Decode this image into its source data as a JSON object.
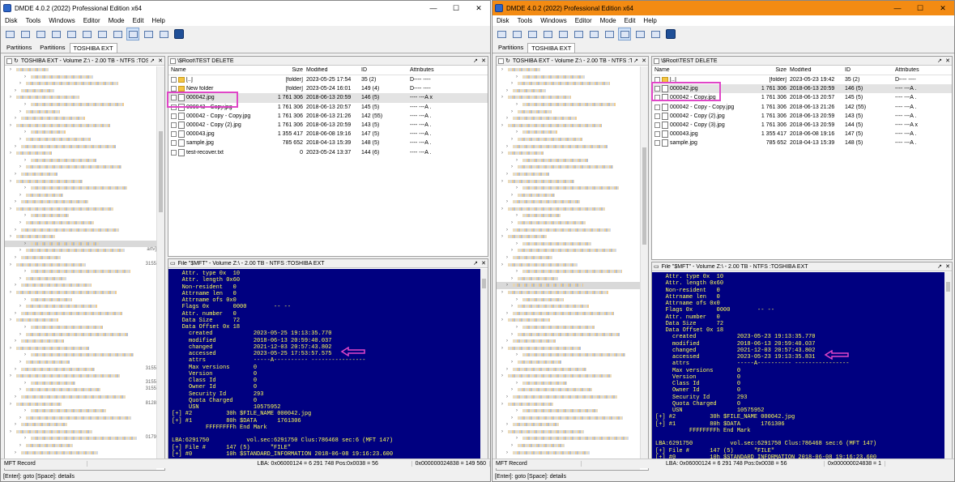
{
  "left": {
    "title": "DMDE 4.0.2 (2022) Professional Edition x64",
    "menu": [
      "Disk",
      "Tools",
      "Windows",
      "Editor",
      "Mode",
      "Edit",
      "Help"
    ],
    "tabs": [
      "Partitions",
      "Partitions",
      "TOSHIBA EXT"
    ],
    "tree_header": "TOSHIBA EXT - Volume Z:\\ - 2.00 TB - NTFS :TOS...",
    "tree_side_labels": [
      "artv]",
      "3155",
      "3155",
      "3155",
      "3155",
      "8128",
      "0179"
    ],
    "file_header": "\\$Root\\TEST DELETE",
    "columns": [
      "Name",
      "Size",
      "Modified",
      "ID",
      "Attributes"
    ],
    "files": [
      {
        "name": "[..]",
        "size": "[folder]",
        "modified": "2023-05-25 17:54",
        "id": "35 (2)",
        "attr": "D---- ----",
        "type": "folder"
      },
      {
        "name": "New folder",
        "size": "[folder]",
        "modified": "2023-05-24 16:01",
        "id": "149 (4)",
        "attr": "D---- ----",
        "type": "folder"
      },
      {
        "name": "000042.jpg",
        "size": "1 761 306",
        "modified": "2018-06-13 20:59",
        "id": "146 (5)",
        "attr": "---- ---A x",
        "type": "file"
      },
      {
        "name": "000042 - Copy.jpg",
        "size": "1 761 306",
        "modified": "2018-06-13 20:57",
        "id": "145 (5)",
        "attr": "---- ---A .",
        "type": "file"
      },
      {
        "name": "000042 - Copy - Copy.jpg",
        "size": "1 761 306",
        "modified": "2018-06-13 21:26",
        "id": "142 (55)",
        "attr": "---- ---A .",
        "type": "file"
      },
      {
        "name": "000042 - Copy (2).jpg",
        "size": "1 761 306",
        "modified": "2018-06-13 20:59",
        "id": "143 (5)",
        "attr": "---- ---A .",
        "type": "file"
      },
      {
        "name": "000043.jpg",
        "size": "1 355 417",
        "modified": "2018-06-08 19:16",
        "id": "147 (5)",
        "attr": "---- ---A .",
        "type": "file"
      },
      {
        "name": "sample.jpg",
        "size": "785 652",
        "modified": "2018-04-13 15:39",
        "id": "148 (5)",
        "attr": "---- ---A .",
        "type": "file"
      },
      {
        "name": "test-recover.txt",
        "size": "0",
        "modified": "2023-05-24 13:37",
        "id": "144 (6)",
        "attr": "---- ---A .",
        "type": "file"
      }
    ],
    "mft_header": "File \"$MFT\" - Volume Z:\\ - 2.00 TB - NTFS :TOSHIBA EXT",
    "mft_lines": [
      "   Attr. type 0x  10",
      "   Attr. length 0x60",
      "   Non-resident   0",
      "   Attrname len   0",
      "   Attrname ofs 0x0",
      "   Flags 0x       0000        -- --",
      "   Attr. number   0",
      "   Data Size      72",
      "   Data Offset 0x 18",
      "     created            2023-05-25 19:13:35.770",
      "     modified           2018-06-13 20:59:40.037",
      "     changed            2021-12-03 20:57:43.802",
      "     accessed           2023-05-25 17:53:57.575",
      "     attrs              -----A---------- ----------------",
      "     Max versions       0",
      "     Version            0",
      "     Class Id           0",
      "     Owner Id           0",
      "     Security Id        293",
      "     Quota Charged      0",
      "     USN                10575952",
      "[+] #2          30h $FILE_NAME 000042.jpg",
      "[+] #1          80h $DATA      1761306",
      "          FFFFFFFFh End Mark",
      "",
      "LBA:6291750           vol.sec:6291750 Clus:786468 sec:6 (MFT 147)",
      "[+] File #      147 (5)      \"FILE\"",
      "[+] #0          10h $STANDARD_INFORMATION 2018-06-08 19:16:23.600"
    ],
    "status": [
      "MFT Record",
      "LBA: 0x06000124 = 6 291 748  Pos:0x0038 = 56",
      "0x000000024838 = 149 560"
    ],
    "bottom_help": "[Enter]: goto  [Space]: details"
  },
  "right": {
    "title": "DMDE 4.0.2 (2022) Professional Edition x64",
    "menu": [
      "Disk",
      "Tools",
      "Windows",
      "Editor",
      "Mode",
      "Edit",
      "Help"
    ],
    "tabs": [
      "Partitions",
      "TOSHIBA EXT"
    ],
    "tree_header": "TOSHIBA EXT - Volume Z:\\ - 2.00 TB - NTFS :TOS...",
    "file_header": "\\$Root\\TEST DELETE",
    "columns": [
      "Name",
      "Size",
      "Modified",
      "ID",
      "Attributes"
    ],
    "files": [
      {
        "name": "[..]",
        "size": "[folder]",
        "modified": "2023-05-23 19:42",
        "id": "35 (2)",
        "attr": "D---- ----",
        "type": "folder"
      },
      {
        "name": "000042.jpg",
        "size": "1 761 306",
        "modified": "2018-06-13 20:59",
        "id": "146 (5)",
        "attr": "---- ---A .",
        "type": "file"
      },
      {
        "name": "000042 - Copy.jpg",
        "size": "1 761 306",
        "modified": "2018-06-13 20:57",
        "id": "145 (5)",
        "attr": "---- ---A .",
        "type": "file"
      },
      {
        "name": "000042 - Copy - Copy.jpg",
        "size": "1 761 306",
        "modified": "2018-06-13 21:26",
        "id": "142 (55)",
        "attr": "---- ---A .",
        "type": "file"
      },
      {
        "name": "000042 - Copy (2).jpg",
        "size": "1 761 306",
        "modified": "2018-06-13 20:59",
        "id": "143 (5)",
        "attr": "---- ---A .",
        "type": "file"
      },
      {
        "name": "000042 - Copy (3).jpg",
        "size": "1 761 306",
        "modified": "2018-06-13 20:59",
        "id": "144 (5)",
        "attr": "---- ---A x",
        "type": "file"
      },
      {
        "name": "000043.jpg",
        "size": "1 355 417",
        "modified": "2018-06-08 19:16",
        "id": "147 (5)",
        "attr": "---- ---A .",
        "type": "file"
      },
      {
        "name": "sample.jpg",
        "size": "785 652",
        "modified": "2018-04-13 15:39",
        "id": "148 (5)",
        "attr": "---- ---A .",
        "type": "file"
      }
    ],
    "mft_header": "File \"$MFT\" - Volume Z:\\ - 2.00 TB - NTFS :TOSHIBA EXT",
    "mft_lines": [
      "   Attr. type 0x  10",
      "   Attr. length 0x60",
      "   Non-resident   0",
      "   Attrname len   0",
      "   Attrname ofs 0x0",
      "   Flags 0x       0000        -- --",
      "   Attr. number   0",
      "   Data Size      72",
      "   Data Offset 0x 18",
      "     created            2023-05-23 19:13:35.770",
      "     modified           2018-06-13 20:59:40.037",
      "     changed            2021-12-03 20:57:43.802",
      "     accessed           2023-05-23 19:13:35.831",
      "     attrs              -----A---------- ----------------",
      "     Max versions       0",
      "     Version            0",
      "     Class Id           0",
      "     Owner Id           0",
      "     Security Id        293",
      "     Quota Charged      0",
      "     USN                10575952",
      "[+] #2          30h $FILE_NAME 000042.jpg",
      "[+] #1          80h $DATA      1761306",
      "          FFFFFFFFh End Mark",
      "",
      "LBA:6291750           vol.sec:6291750 Clus:786468 sec:6 (MFT 147)",
      "[+] File #      147 (5)      \"FILE\"",
      "[+] #0          10h $STANDARD_INFORMATION 2018-06-08 19:16:23.600"
    ],
    "status": [
      "MFT Record",
      "LBA: 0x06000124 = 6 291 748  Pos:0x0038 = 56",
      "0x000000024838 = 1"
    ],
    "bottom_help": "[Enter]: goto  [Space]: details"
  },
  "colors": {
    "highlight": "#e046c7",
    "hex_bg": "#000080",
    "hex_fg": "#ffff55",
    "active_title": "#f38b13"
  }
}
